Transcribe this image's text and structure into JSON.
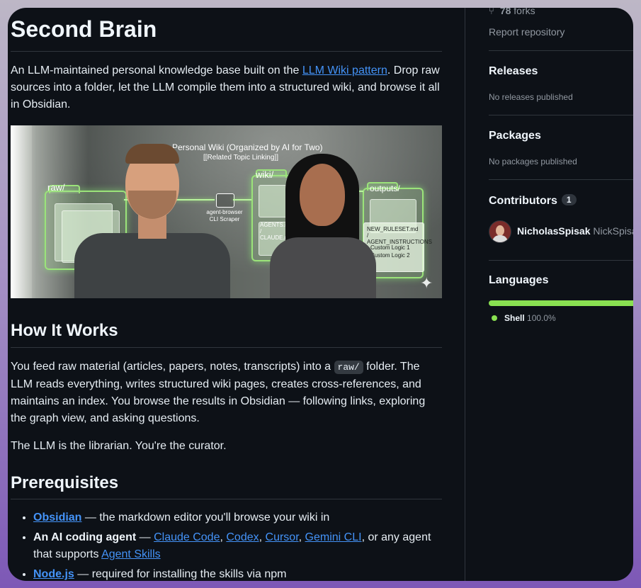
{
  "readme": {
    "title": "Second Brain",
    "intro": {
      "before": "An LLM-maintained personal knowledge base built on the ",
      "link": "LLM Wiki pattern",
      "after": ". Drop raw sources into a folder, let the LLM compile them into a structured wiki, and browse it all in Obsidian."
    },
    "hero": {
      "diagram_title": "Personal Wiki (Organized by AI for Two)",
      "related": "[[Related Topic Linking]]",
      "raw": "raw/",
      "wiki": "wiki/",
      "outputs": "outputs/",
      "scraper": "agent-browser CLI Scraper",
      "agents_md": "AGENTS.md / CLAUDE.md",
      "ruleset": "NEW_RULESET.md / AGENT_INSTRUCTIONS",
      "logic1": "• Custom Logic 1",
      "logic2": "• Custom Logic 2"
    },
    "how_heading": "How It Works",
    "how_p1": {
      "before": "You feed raw material (articles, papers, notes, transcripts) into a ",
      "code": "raw/",
      "after": " folder. The LLM reads everything, writes structured wiki pages, creates cross-references, and maintains an index. You browse the results in Obsidian — following links, exploring the graph view, and asking questions."
    },
    "how_p2": "The LLM is the librarian. You're the curator.",
    "prereq_heading": "Prerequisites",
    "prereqs": {
      "obsidian": {
        "link": "Obsidian",
        "text": " — the markdown editor you'll browse your wiki in"
      },
      "agent": {
        "bold": "An AI coding agent",
        "dash": " — ",
        "links": [
          "Claude Code",
          "Codex",
          "Cursor",
          "Gemini CLI"
        ],
        "sep": ", ",
        "tail": ", or any agent that supports ",
        "skills": "Agent Skills"
      },
      "node": {
        "link": "Node.js",
        "text": " — required for installing the skills via npm"
      }
    }
  },
  "sidebar": {
    "forks": {
      "count": "78",
      "label": "forks"
    },
    "report": "Report repository",
    "releases": {
      "heading": "Releases",
      "empty": "No releases published"
    },
    "packages": {
      "heading": "Packages",
      "empty": "No packages published"
    },
    "contributors": {
      "heading": "Contributors",
      "count": "1",
      "user": "NicholasSpisak",
      "handle": "NickSpisak"
    },
    "languages": {
      "heading": "Languages",
      "name": "Shell",
      "percent": "100.0%",
      "share": 100,
      "color": "#89e051"
    }
  },
  "colors": {
    "background": "#0d1117",
    "link": "#4493f8",
    "border": "#30363d",
    "muted": "#9198a1"
  }
}
